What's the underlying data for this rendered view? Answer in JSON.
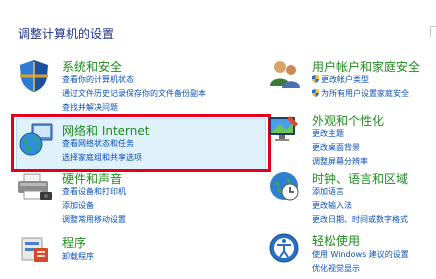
{
  "page_title": "调整计算机的设置",
  "categories": {
    "system_security": {
      "title": "系统和安全",
      "links": [
        "查看你的计算机状态",
        "通过文件历史记录保存你的文件备份副本",
        "查找并解决问题"
      ]
    },
    "user_accounts": {
      "title": "用户帐户和家庭安全",
      "links": [
        "更改帐户类型",
        "为所有用户设置家庭安全"
      ]
    },
    "network": {
      "title": "网络和 Internet",
      "links": [
        "查看网络状态和任务",
        "选择家庭组和共享选项"
      ]
    },
    "appearance": {
      "title": "外观和个性化",
      "links": [
        "更改主题",
        "更改桌面背景",
        "调整屏幕分辨率"
      ]
    },
    "hardware": {
      "title": "硬件和声音",
      "links": [
        "查看设备和打印机",
        "添加设备",
        "调整常用移动设置"
      ]
    },
    "clock": {
      "title": "时钟、语言和区域",
      "links": [
        "添加语言",
        "更改输入法",
        "更改日期、时间或数字格式"
      ]
    },
    "programs": {
      "title": "程序",
      "links": [
        "卸载程序"
      ]
    },
    "ease": {
      "title": "轻松使用",
      "links": [
        "使用 Windows 建议的设置",
        "优化视觉显示"
      ]
    }
  },
  "colors": {
    "title_blue": "#1e3287",
    "category_green": "#1e8c1e",
    "link_blue": "#0b4fb5",
    "highlight_red": "#e2001a",
    "highlight_bg": "#dff1fb"
  }
}
